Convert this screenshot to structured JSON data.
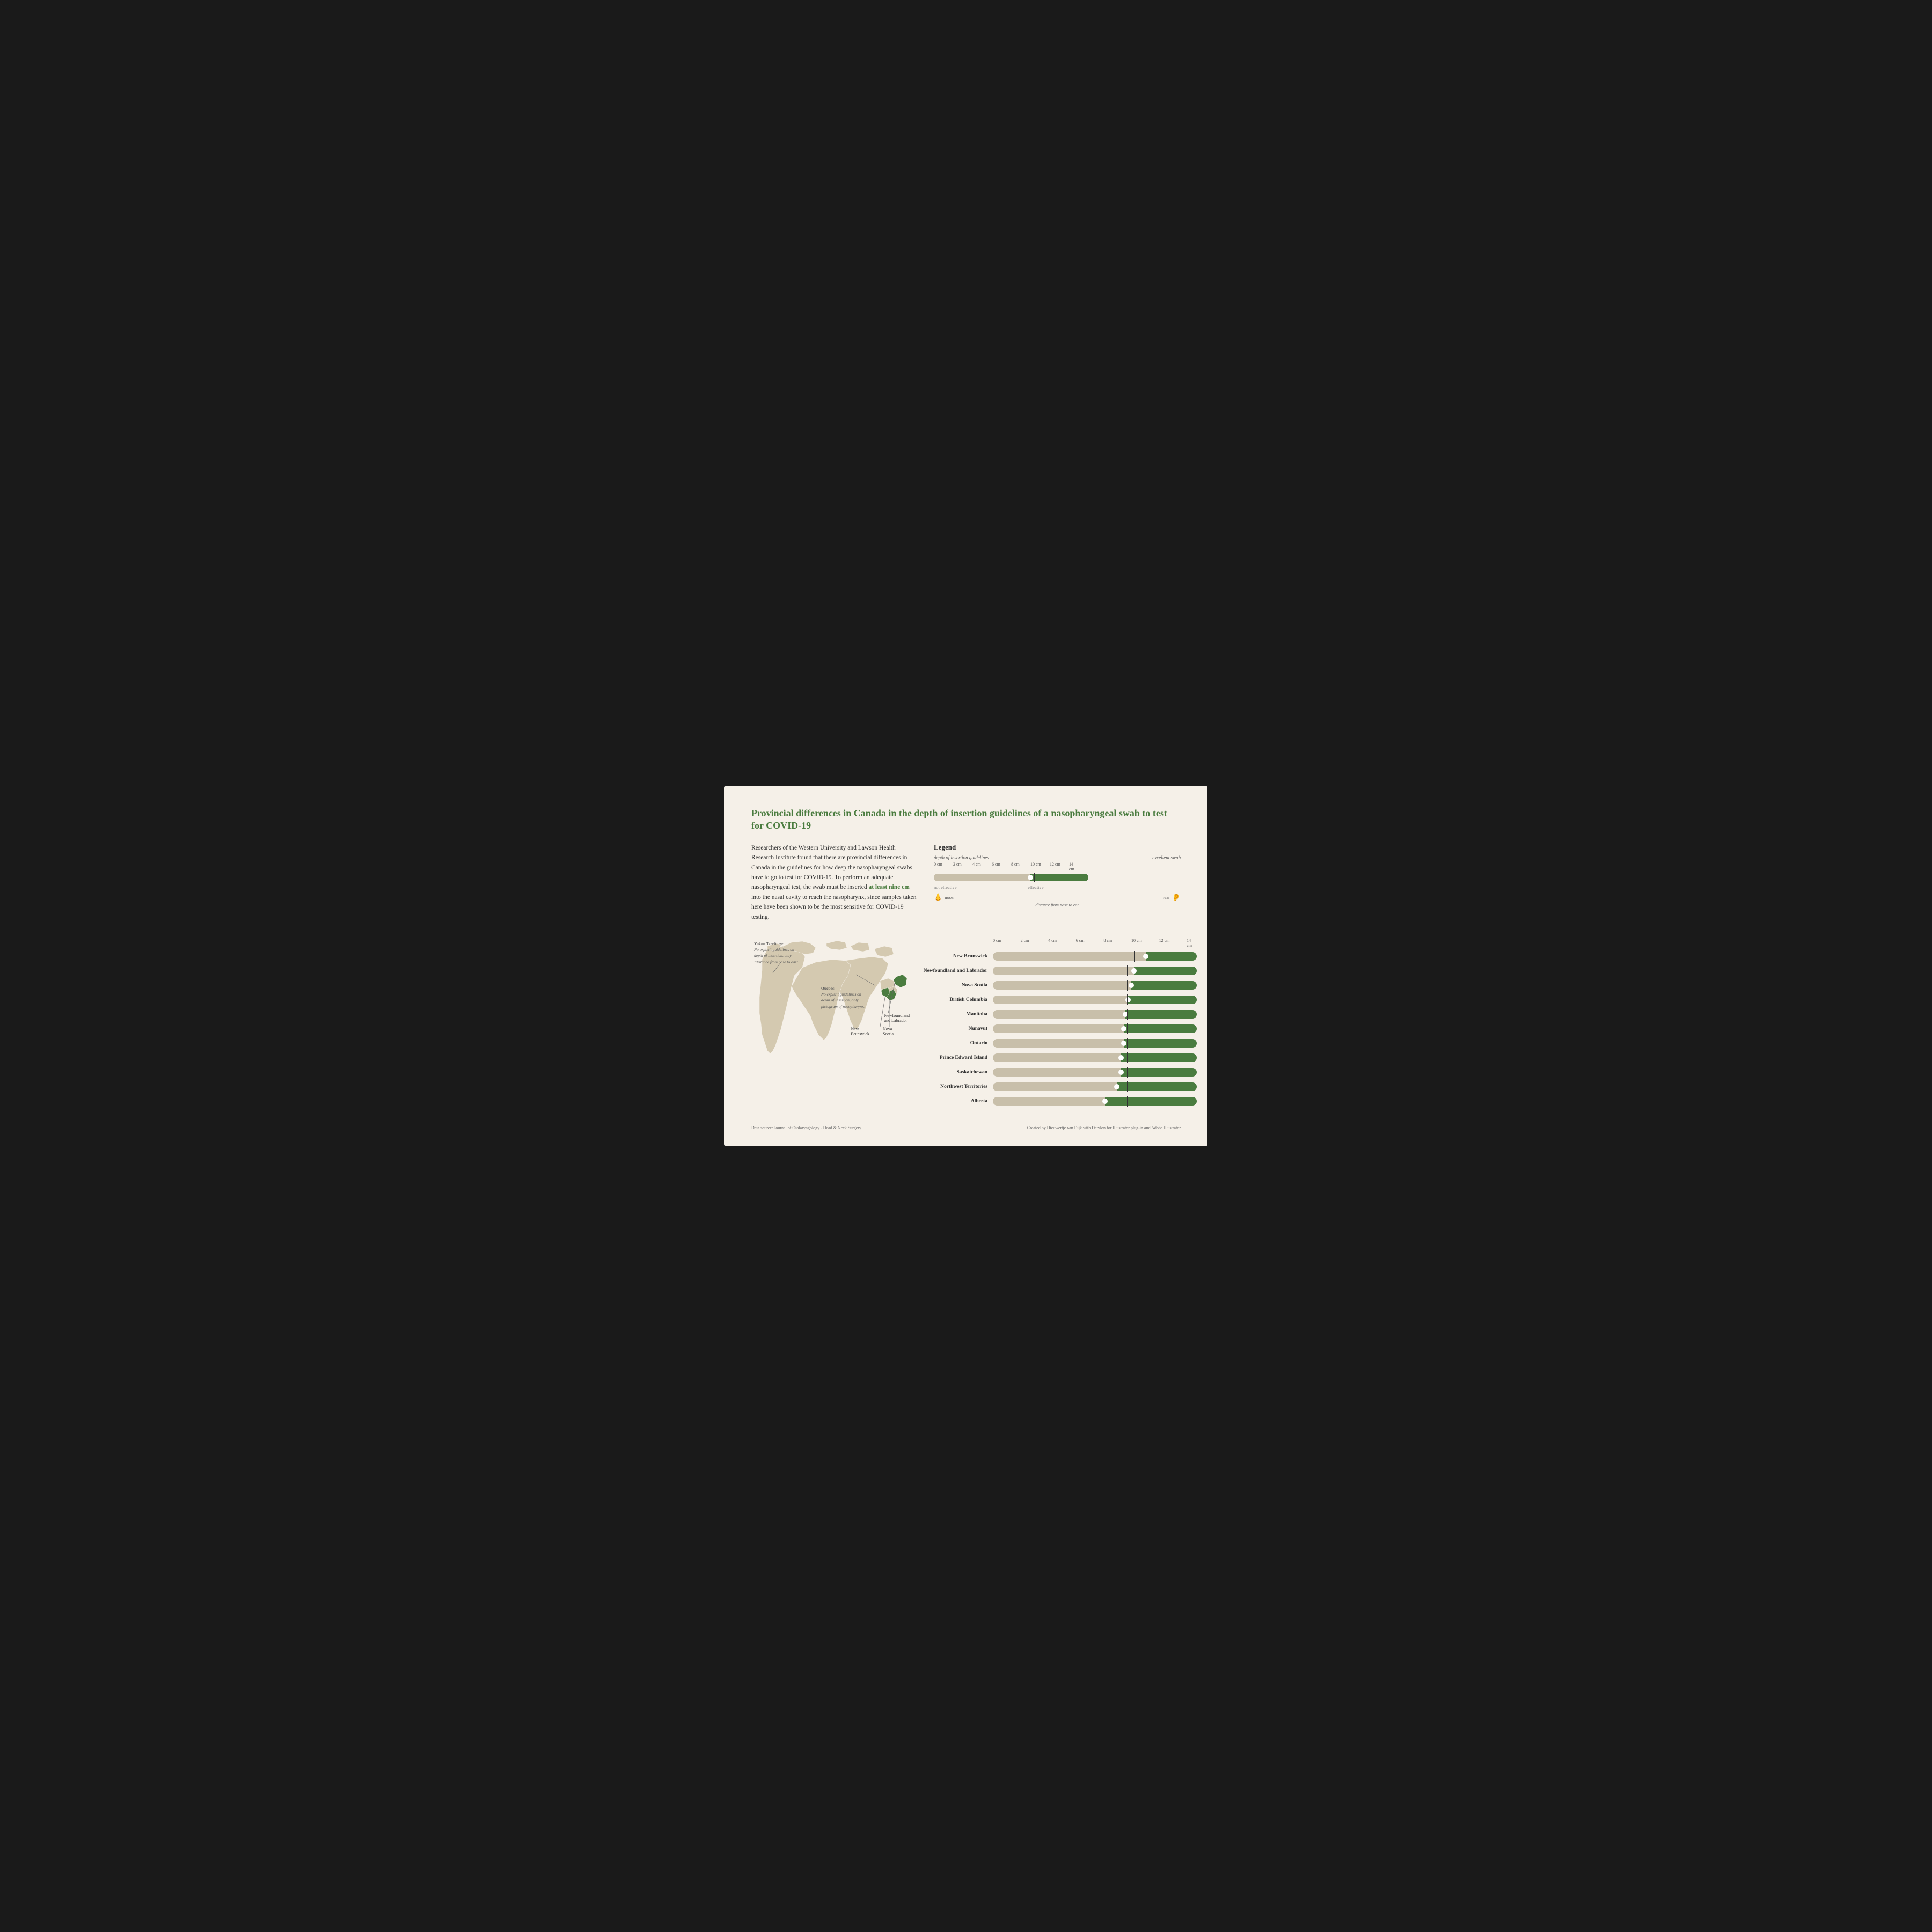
{
  "title": "Provincial differences in Canada in the depth of insertion guidelines of a nasopharyngeal swab to test for COVID-19",
  "intro": {
    "text": "Researchers of the Western University and Lawson Health Research Institute found that there are provincial differences in Canada in the guidelines for how deep the nasopharyngeal swabs have to go to test for COVID-19. To perform an adequate nasopharyngeal test, the swab must be inserted ",
    "highlight": "at least nine cm",
    "text2": " into the nasal cavity to reach the nasopharynx, since samples taken here have been shown to be the most sensitive for COVID-19 testing."
  },
  "legend": {
    "title": "Legend",
    "label_left": "depth of insertion guidelines",
    "label_right": "excellent swab",
    "scale_labels": [
      "0 cm",
      "2 cm",
      "4 cm",
      "6 cm",
      "8 cm",
      "10 cm",
      "12 cm",
      "14 cm"
    ],
    "not_effective": "not effective",
    "effective": "effective",
    "nose_label": "nose",
    "ear_label": "ear",
    "distance_label": "distance from nose to ear"
  },
  "map_annotations": {
    "yukon": {
      "title": "Yukon Territory:",
      "text": "No explicit guidelines on depth of insertion, only \"distance from nose to ear\"."
    },
    "quebec": {
      "title": "Quebec:",
      "text": "No explicit guidelines on depth of insertion, only pictogram of nasopharynx."
    },
    "newfoundland": "Newfoundland\nand Labrador",
    "nova_scotia": "Nova\nScotia",
    "new_brunswick": "New\nBrunswick"
  },
  "chart": {
    "scale_labels": [
      "0 cm",
      "2 cm",
      "4 cm",
      "6 cm",
      "8 cm",
      "10 cm",
      "12 cm",
      "14 cm"
    ],
    "provinces": [
      {
        "name": "New Brunswick",
        "tan_pct": 68,
        "green_pct": 32,
        "marker_pct": 72
      },
      {
        "name": "Newfoundland and Labrador",
        "tan_pct": 64,
        "green_pct": 36,
        "marker_pct": 65
      },
      {
        "name": "Nova Scotia",
        "tan_pct": 63,
        "green_pct": 37,
        "marker_pct": 65
      },
      {
        "name": "British Columbia",
        "tan_pct": 62,
        "green_pct": 38,
        "marker_pct": 65
      },
      {
        "name": "Manitoba",
        "tan_pct": 61,
        "green_pct": 39,
        "marker_pct": 65
      },
      {
        "name": "Nunavut",
        "tan_pct": 60,
        "green_pct": 40,
        "marker_pct": 65
      },
      {
        "name": "Ontario",
        "tan_pct": 60,
        "green_pct": 40,
        "marker_pct": 65
      },
      {
        "name": "Prince Edward Island",
        "tan_pct": 59,
        "green_pct": 41,
        "marker_pct": 65
      },
      {
        "name": "Saskatchewan",
        "tan_pct": 59,
        "green_pct": 41,
        "marker_pct": 65
      },
      {
        "name": "Northwest Territories",
        "tan_pct": 57,
        "green_pct": 43,
        "marker_pct": 65
      },
      {
        "name": "Alberta",
        "tan_pct": 53,
        "green_pct": 47,
        "marker_pct": 65
      }
    ]
  },
  "footer": {
    "source": "Data source: Journal of Otolaryngology - Head & Neck Surgery",
    "credit": "Created by Dieuwertje van Dijk with Datylon for Illustrator plug-in and Adobe Illustrator"
  }
}
